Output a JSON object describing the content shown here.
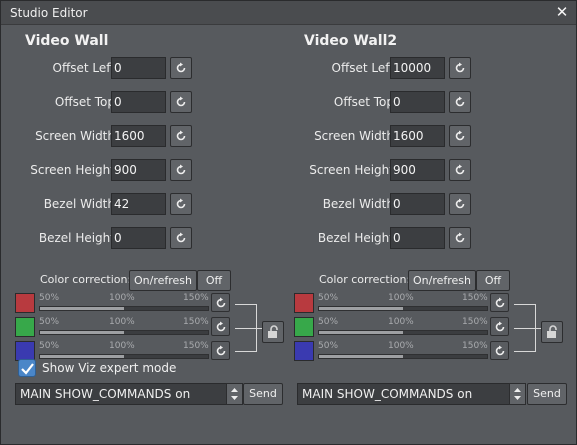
{
  "window": {
    "title": "Studio Editor"
  },
  "walls": [
    {
      "name": "Video Wall",
      "fields": [
        {
          "label": "Offset Left",
          "value": "0"
        },
        {
          "label": "Offset Top",
          "value": "0"
        },
        {
          "label": "Screen Width",
          "value": "1600"
        },
        {
          "label": "Screen Height",
          "value": "900"
        },
        {
          "label": "Bezel Width",
          "value": "42"
        },
        {
          "label": "Bezel Height",
          "value": "0"
        }
      ],
      "color_correction": {
        "label": "Color correction:",
        "on_label": "On/refresh",
        "off_label": "Off",
        "channels": [
          {
            "color": "#b83a3f",
            "level_percent": 100
          },
          {
            "color": "#37a84a",
            "level_percent": 100
          },
          {
            "color": "#3a3ab0",
            "level_percent": 100
          }
        ],
        "ticks": [
          "50%",
          "100%",
          "150%"
        ]
      }
    },
    {
      "name": "Video Wall2",
      "fields": [
        {
          "label": "Offset Left",
          "value": "10000"
        },
        {
          "label": "Offset Top",
          "value": "0"
        },
        {
          "label": "Screen Width",
          "value": "1600"
        },
        {
          "label": "Screen Height",
          "value": "900"
        },
        {
          "label": "Bezel Width",
          "value": "0"
        },
        {
          "label": "Bezel Height",
          "value": "0"
        }
      ],
      "color_correction": {
        "label": "Color correction:",
        "on_label": "On/refresh",
        "off_label": "Off",
        "channels": [
          {
            "color": "#b83a3f",
            "level_percent": 100
          },
          {
            "color": "#37a84a",
            "level_percent": 100
          },
          {
            "color": "#3a3ab0",
            "level_percent": 100
          }
        ],
        "ticks": [
          "50%",
          "100%",
          "150%"
        ]
      }
    }
  ],
  "expert_mode": {
    "label": "Show Viz expert mode",
    "checked": true
  },
  "commands": [
    {
      "value": "MAIN SHOW_COMMANDS on",
      "send_label": "Send"
    },
    {
      "value": "MAIN SHOW_COMMANDS on",
      "send_label": "Send"
    }
  ],
  "icons": {
    "reset": "reset-icon",
    "lock": "unlock-icon",
    "close": "close-icon"
  }
}
